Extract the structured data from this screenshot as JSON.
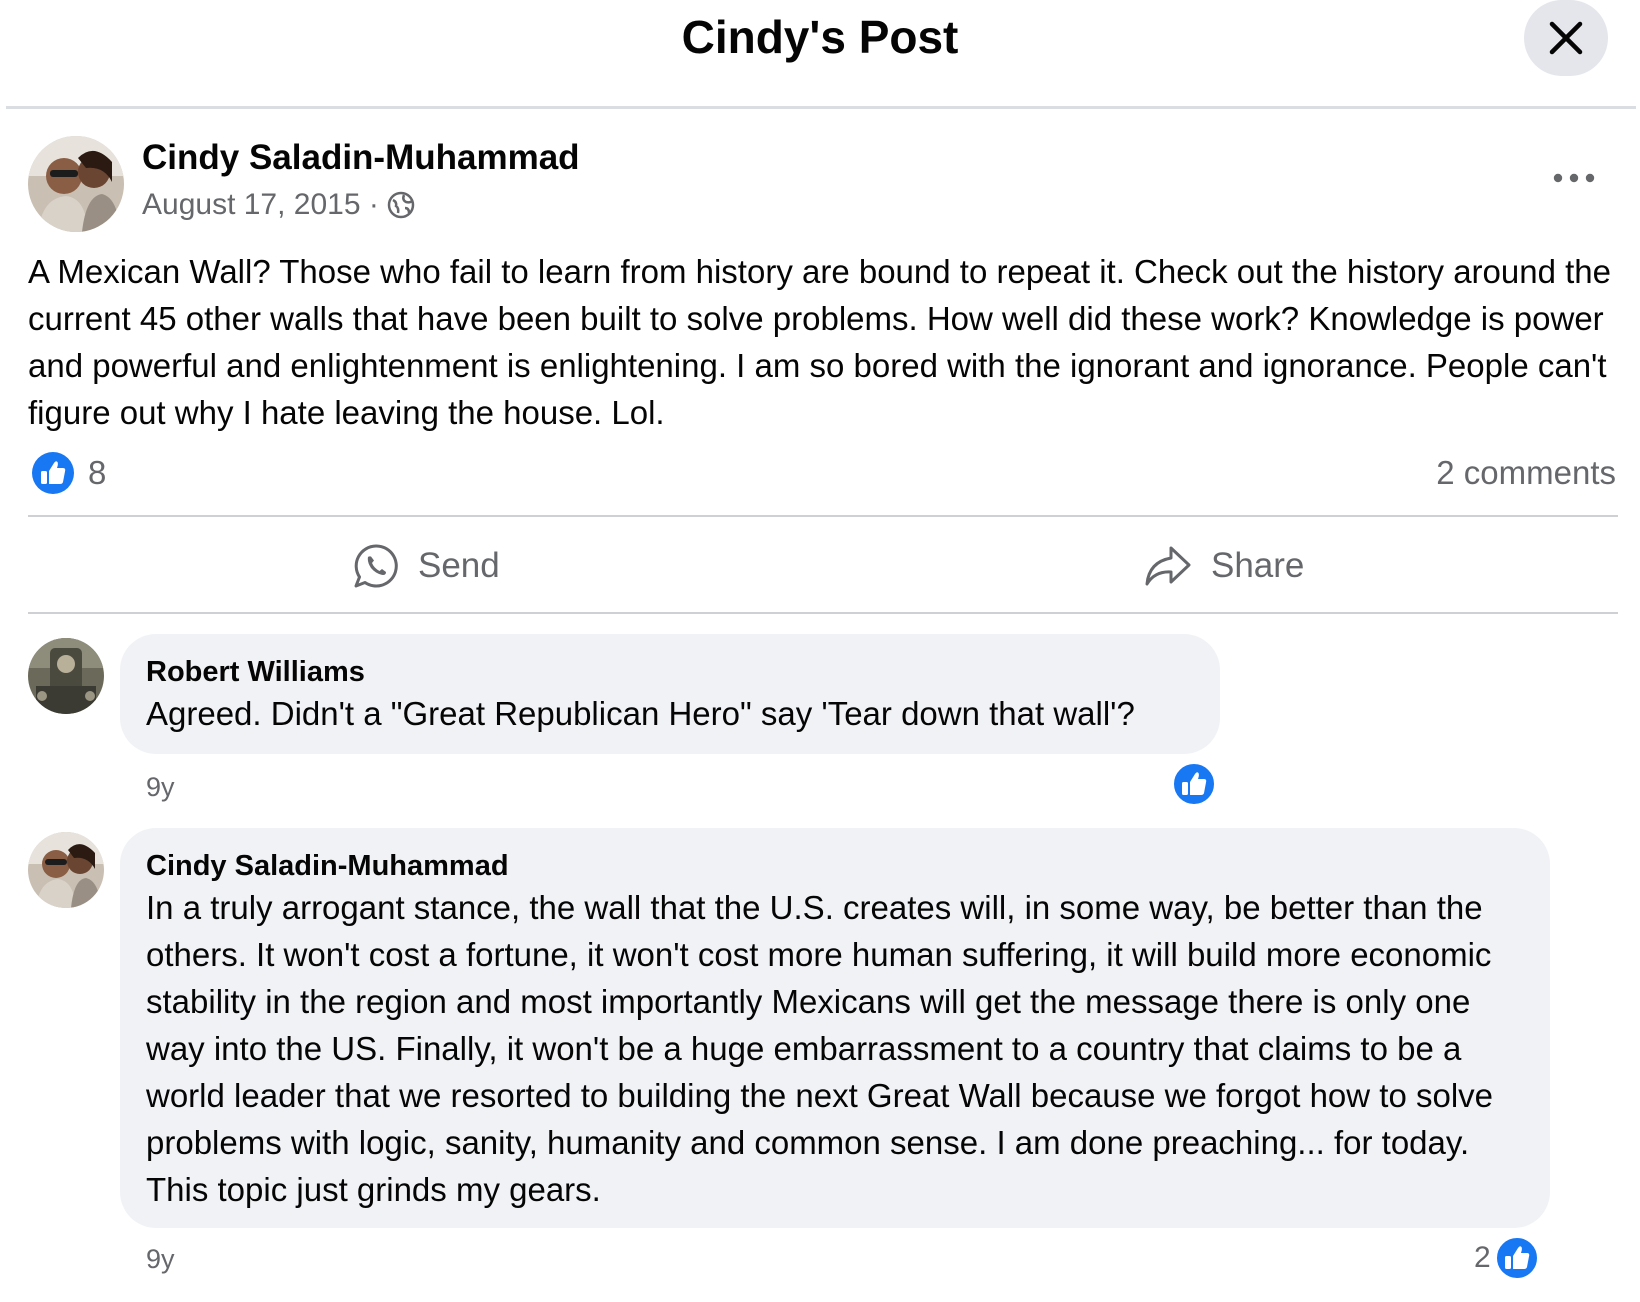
{
  "header": {
    "title": "Cindy's Post",
    "close_icon": "close-icon"
  },
  "post": {
    "author": "Cindy Saladin-Muhammad",
    "date": "August 17, 2015 ·",
    "privacy_icon": "globe-icon",
    "more_icon": "more-horizontal-icon",
    "text": "A Mexican Wall? Those who fail to learn from history are bound to repeat it. Check out the history around the current 45 other walls that have been built to solve problems. How well did these work? Knowledge is power and powerful and enlightenment is enlightening. I am so bored with the ignorant and ignorance. People can't figure out why I hate leaving the house. Lol.",
    "reaction_count": "8",
    "comments_label": "2 comments",
    "actions": {
      "send_label": "Send",
      "share_label": "Share"
    }
  },
  "comments": [
    {
      "author": "Robert Williams",
      "text": "Agreed. Didn't a \"Great Republican Hero\" say 'Tear down that wall'?",
      "time": "9y",
      "like_count": ""
    },
    {
      "author": "Cindy Saladin-Muhammad",
      "text": "In a truly arrogant stance, the wall that the U.S. creates will, in some way, be better than the others. It won't cost a fortune, it won't cost more human suffering, it will build more economic stability in the region and most importantly Mexicans will get the message there is only one way into the US. Finally, it won't be a huge embarrassment to a country that claims to be a world leader that we resorted to building the next Great Wall because we forgot how to solve problems with logic, sanity, humanity and common sense. I am done preaching... for today. This topic just grinds my gears.",
      "time": "9y",
      "like_count": "2"
    }
  ],
  "colors": {
    "like_blue": "#1877f2",
    "secondary_text": "#65676b",
    "bubble_bg": "#f0f2f5"
  }
}
